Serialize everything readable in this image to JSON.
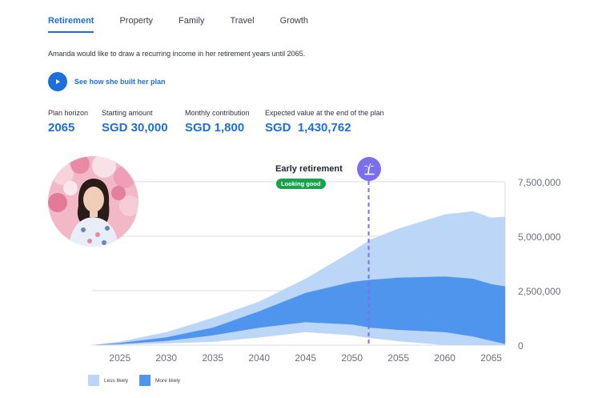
{
  "tabs": [
    {
      "label": "Retirement",
      "active": true
    },
    {
      "label": "Property",
      "active": false
    },
    {
      "label": "Family",
      "active": false
    },
    {
      "label": "Travel",
      "active": false
    },
    {
      "label": "Growth",
      "active": false
    }
  ],
  "intro": "Amanda would like to draw a recurring income in her retirement years until 2065.",
  "cta": {
    "label": "See how she built her plan",
    "icon": "play-icon"
  },
  "stats": [
    {
      "label": "Plan horizon",
      "value": "2065"
    },
    {
      "label": "Starting amount",
      "value": "SGD 30,000"
    },
    {
      "label": "Monthly contribution",
      "value": "SGD 1,800"
    },
    {
      "label": "Expected value at the end of the plan",
      "value": "SGD  1,430,762"
    }
  ],
  "marker": {
    "title": "Early retirement",
    "badge": "Looking good",
    "icon": "palm-tree-icon",
    "year": 2051.8
  },
  "legend": [
    {
      "label": "Less likely",
      "color": "#bcd6f7"
    },
    {
      "label": "More likely",
      "color": "#4f95ee"
    }
  ],
  "colors": {
    "accent": "#1c6fd8",
    "marker": "#7b6ff0",
    "badge": "#16a34a"
  },
  "chart_data": {
    "type": "area",
    "x": [
      2022,
      2025,
      2030,
      2035,
      2040,
      2045,
      2050,
      2052,
      2055,
      2060,
      2063,
      2065,
      2066.5
    ],
    "series": [
      {
        "name": "Less likely",
        "role": "outer-upper",
        "values": [
          0,
          160000,
          600000,
          1250000,
          2000000,
          3050000,
          4300000,
          4850000,
          5350000,
          6000000,
          6150000,
          5850000,
          5900000
        ]
      },
      {
        "name": "More likely",
        "role": "inner-upper",
        "values": [
          0,
          100000,
          360000,
          800000,
          1550000,
          2400000,
          2900000,
          3000000,
          3100000,
          3150000,
          3050000,
          2800000,
          2700000
        ]
      },
      {
        "name": "More likely",
        "role": "inner-lower",
        "values": [
          0,
          50000,
          190000,
          450000,
          800000,
          1050000,
          950000,
          800000,
          700000,
          600000,
          400000,
          200000,
          50000
        ]
      },
      {
        "name": "Less likely",
        "role": "outer-lower",
        "values": [
          0,
          20000,
          80000,
          150000,
          350000,
          600000,
          450000,
          320000,
          180000,
          0,
          0,
          0,
          0
        ]
      }
    ],
    "xticks": [
      "2025",
      "2030",
      "2035",
      "2040",
      "2045",
      "2050",
      "2055",
      "2060",
      "2065"
    ],
    "yticks": [
      "7,500,000",
      "5,000,000",
      "2,500,000",
      "0"
    ],
    "xlim": [
      2022,
      2066.5
    ],
    "ylim": [
      0,
      7500000
    ],
    "xlabel": "",
    "ylabel": "",
    "grid": true
  }
}
